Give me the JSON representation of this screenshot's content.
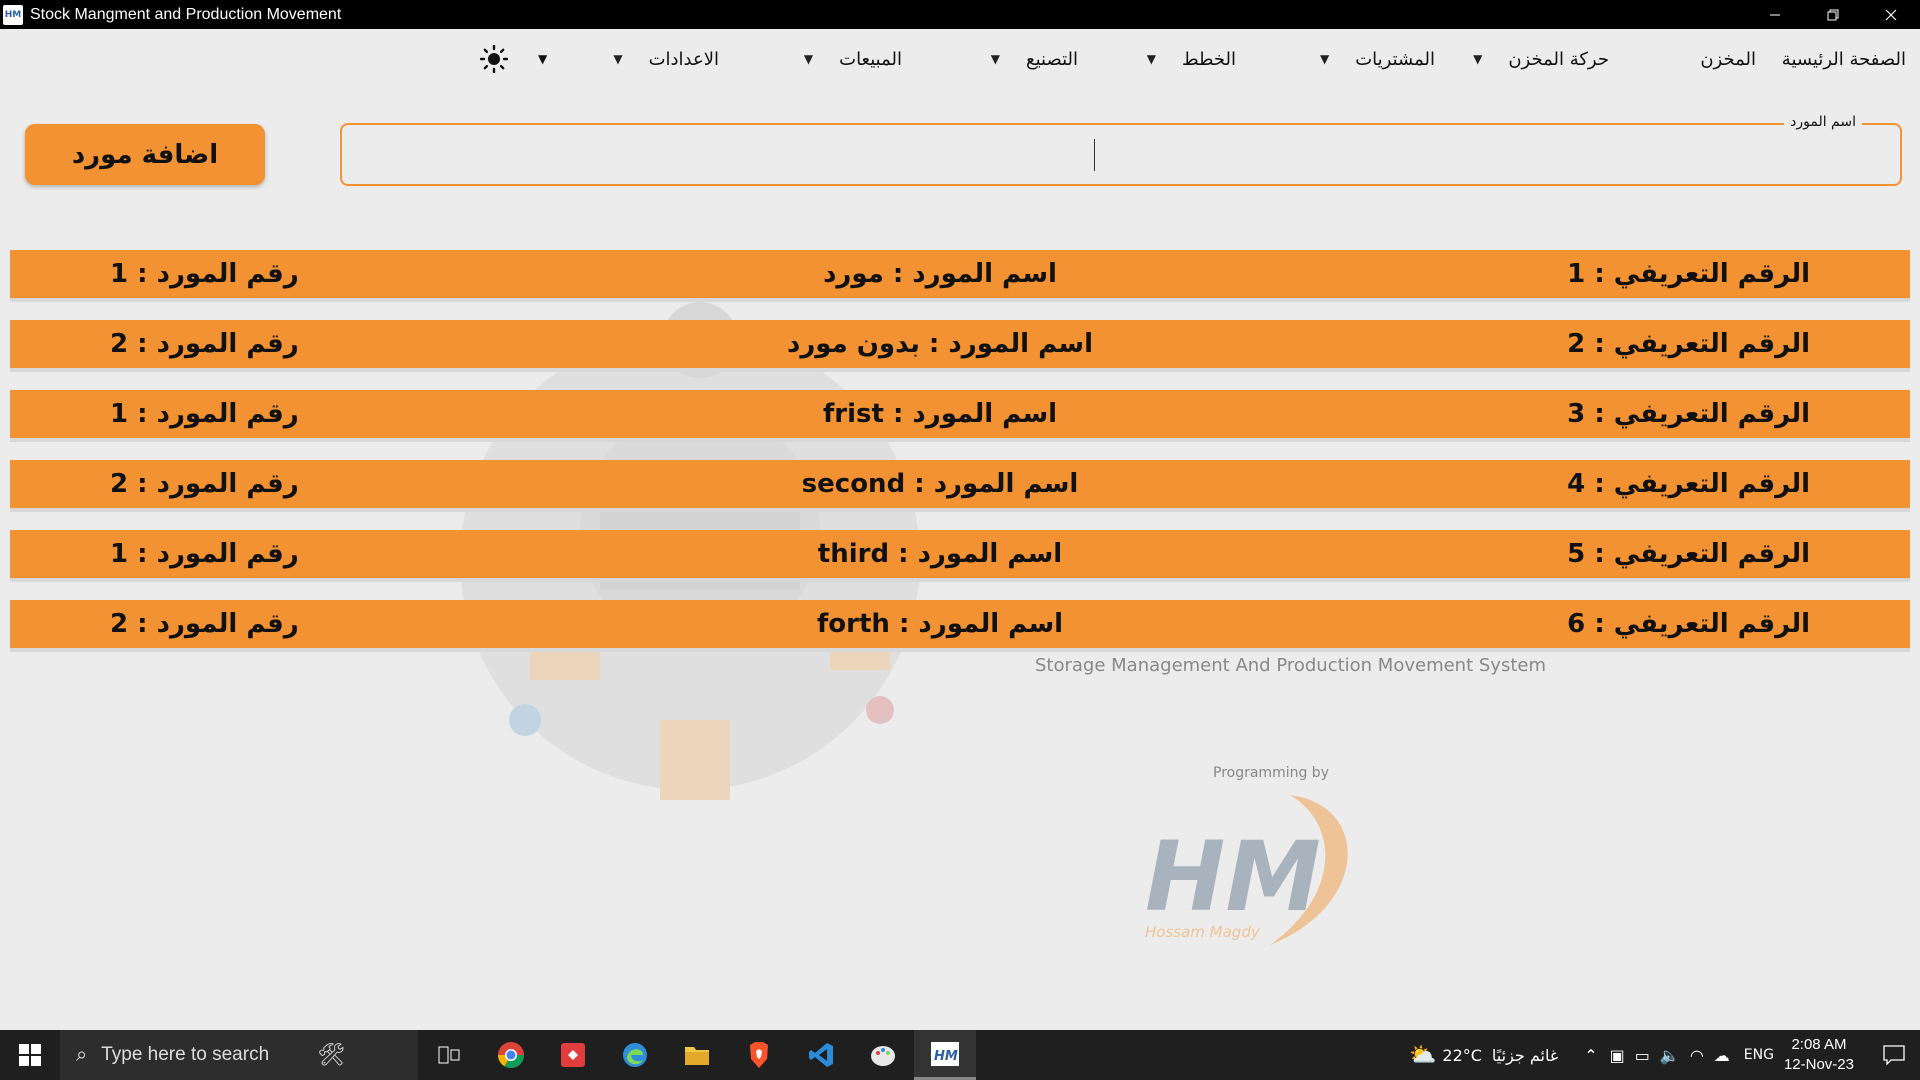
{
  "window": {
    "title": "Stock Mangment and Production Movement",
    "app_icon_text": "HM",
    "controls": [
      "minimize",
      "restore",
      "close"
    ]
  },
  "menu": {
    "items": [
      {
        "label": "الصفحة الرئيسية",
        "dropdown": false
      },
      {
        "label": "المخزن",
        "dropdown": false
      },
      {
        "label": "حركة المخزن",
        "dropdown": true
      },
      {
        "label": "المشتريات",
        "dropdown": true
      },
      {
        "label": "الخطط",
        "dropdown": true
      },
      {
        "label": "التصنيع",
        "dropdown": true
      },
      {
        "label": "المبيعات",
        "dropdown": true
      },
      {
        "label": "الاعدادات",
        "dropdown": true
      }
    ],
    "theme_toggle_icon": "sun-icon"
  },
  "form": {
    "supplier_name_label": "اسم المورد",
    "supplier_name_value": "",
    "add_button_label": "اضافة مورد"
  },
  "suppliers": [
    {
      "id_text": "الرقم التعريفي : 1",
      "name_text": "اسم المورد : مورد",
      "num_text": "رقم المورد : 1"
    },
    {
      "id_text": "الرقم التعريفي : 2",
      "name_text": "اسم المورد : بدون مورد",
      "num_text": "رقم المورد : 2"
    },
    {
      "id_text": "الرقم التعريفي : 3",
      "name_text": "اسم المورد : frist",
      "num_text": "رقم المورد : 1"
    },
    {
      "id_text": "الرقم التعريفي : 4",
      "name_text": "اسم المورد : second",
      "num_text": "رقم المورد : 2"
    },
    {
      "id_text": "الرقم التعريفي : 5",
      "name_text": "اسم المورد : third",
      "num_text": "رقم المورد : 1"
    },
    {
      "id_text": "الرقم التعريفي : 6",
      "name_text": "اسم المورد : forth",
      "num_text": "رقم المورد : 2"
    }
  ],
  "background": {
    "subtitle": "Storage Management And Production Movement System",
    "programming_by": "Programming by",
    "logo_text": "HM",
    "author": "Hossam Magdy"
  },
  "taskbar": {
    "search_placeholder": "Type here to search",
    "weather_temp": "22°C",
    "weather_text": "غائم جزئيًا",
    "language": "ENG",
    "time": "2:08 AM",
    "date": "12-Nov-23"
  },
  "colors": {
    "accent": "#f29232",
    "background": "#ececec",
    "titlebar": "#000000",
    "taskbar": "#1f1f1f"
  }
}
